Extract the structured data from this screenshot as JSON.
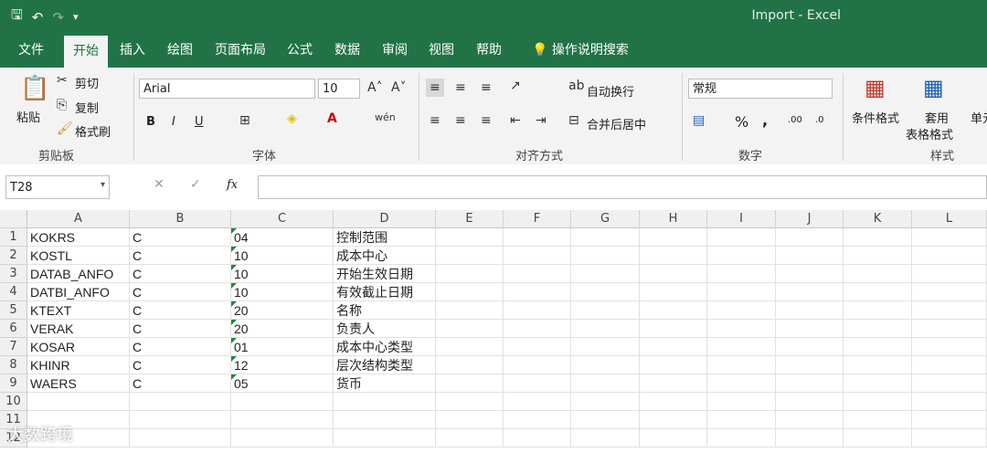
{
  "window": {
    "title": "Import  -  Excel"
  },
  "tabs": [
    "文件",
    "开始",
    "插入",
    "绘图",
    "页面布局",
    "公式",
    "数据",
    "审阅",
    "视图",
    "帮助",
    "操作说明搜索"
  ],
  "clipboard": {
    "paste": "粘贴",
    "cut": "剪切",
    "copy": "复制",
    "format_painter": "格式刷",
    "label": "剪贴板"
  },
  "font": {
    "name": "Arial",
    "size": "10",
    "bold": "B",
    "italic": "I",
    "underline": "U",
    "label": "字体"
  },
  "alignment": {
    "wrap": "自动换行",
    "merge": "合并后居中",
    "label": "对齐方式"
  },
  "number": {
    "format": "常规",
    "percent": "%",
    "comma": ",",
    "inc": ".00",
    "dec": ".0",
    "label": "数字"
  },
  "styles": {
    "cond": "条件格式",
    "table1": "套用",
    "table2": "表格格式",
    "cell": "单元",
    "label": "样式"
  },
  "formula": {
    "namebox": "T28",
    "fx": "fx"
  },
  "columns": [
    "A",
    "B",
    "C",
    "D",
    "E",
    "F",
    "G",
    "H",
    "I",
    "J",
    "K",
    "L"
  ],
  "rows": [
    [
      "KOKRS",
      "C",
      "04",
      "控制范围"
    ],
    [
      "KOSTL",
      "C",
      "10",
      "成本中心"
    ],
    [
      "DATAB_ANFO",
      "C",
      "10",
      "开始生效日期"
    ],
    [
      "DATBI_ANFO",
      "C",
      "10",
      "有效截止日期"
    ],
    [
      "KTEXT",
      "C",
      "20",
      "名称"
    ],
    [
      "VERAK",
      "C",
      "20",
      "负责人"
    ],
    [
      "KOSAR",
      "C",
      "01",
      "成本中心类型"
    ],
    [
      "KHINR",
      "C",
      "12",
      "层次结构类型"
    ],
    [
      "WAERS",
      "C",
      "05",
      "货币"
    ]
  ],
  "row_numbers": [
    "1",
    "2",
    "3",
    "4",
    "5",
    "6",
    "7",
    "8",
    "9",
    "10",
    "11",
    "12"
  ],
  "watermark": "大数跨境"
}
